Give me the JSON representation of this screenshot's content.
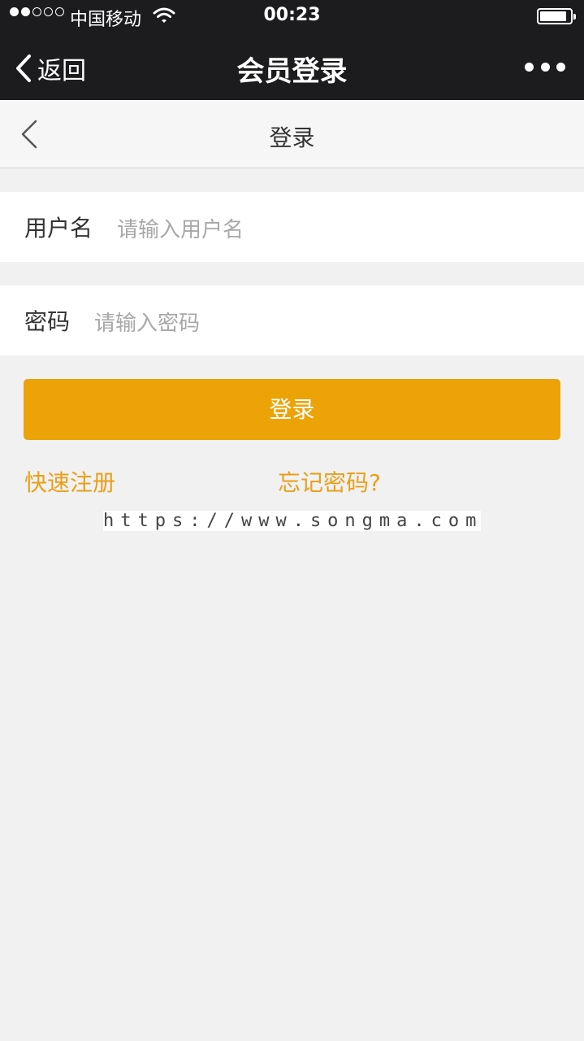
{
  "status_bar": {
    "carrier": "中国移动",
    "time": "00:23",
    "signal_bars_filled": 2,
    "signal_bars_total": 5,
    "battery_level": 0.9
  },
  "nav_bar": {
    "back_label": "返回",
    "title": "会员登录",
    "more_icon": "more-dots-icon"
  },
  "page_header": {
    "title": "登录",
    "back_icon": "chevron-left-icon"
  },
  "form": {
    "username": {
      "label": "用户名",
      "placeholder": "请输入用户名",
      "value": ""
    },
    "password": {
      "label": "密码",
      "placeholder": "请输入密码",
      "value": ""
    },
    "submit_label": "登录"
  },
  "links": {
    "register": "快速注册",
    "forgot": "忘记密码?"
  },
  "watermark": "https://www.songma.com",
  "colors": {
    "accent": "#eba307",
    "link": "#e8a01a",
    "nav_bg": "#1c1c1e",
    "page_bg": "#f1f1f1"
  }
}
